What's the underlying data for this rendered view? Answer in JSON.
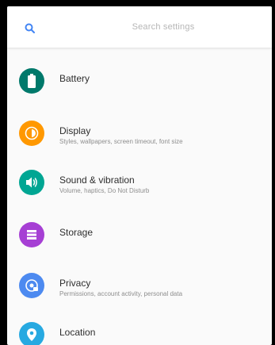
{
  "search": {
    "placeholder": "Search settings",
    "icon": "search-icon",
    "icon_color": "#4285f4"
  },
  "settings_items": [
    {
      "id": "battery",
      "title": "Battery",
      "subtitle": "",
      "icon": "battery-icon",
      "color": "#00796b"
    },
    {
      "id": "display",
      "title": "Display",
      "subtitle": "Styles, wallpapers, screen timeout, font size",
      "icon": "brightness-icon",
      "color": "#ff9800"
    },
    {
      "id": "sound",
      "title": "Sound & vibration",
      "subtitle": "Volume, haptics, Do Not Disturb",
      "icon": "volume-icon",
      "color": "#00a693"
    },
    {
      "id": "storage",
      "title": "Storage",
      "subtitle": "",
      "icon": "storage-icon",
      "color": "#a63fd4"
    },
    {
      "id": "privacy",
      "title": "Privacy",
      "subtitle": "Permissions, account activity, personal data",
      "icon": "privacy-icon",
      "color": "#4d8af0"
    },
    {
      "id": "location",
      "title": "Location",
      "subtitle": "",
      "icon": "location-pin-icon",
      "color": "#27a9e1"
    }
  ]
}
